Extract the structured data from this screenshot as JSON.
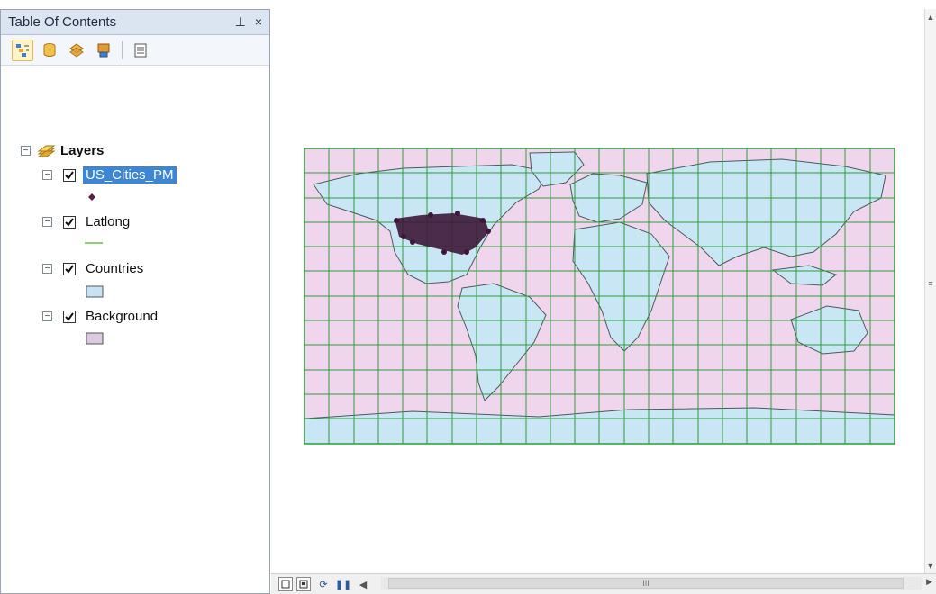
{
  "toc": {
    "title": "Table Of Contents",
    "pin_glyph": "⊥",
    "close_glyph": "×",
    "toolbar": [
      {
        "name": "list-by-drawing-order-icon"
      },
      {
        "name": "list-by-source-icon"
      },
      {
        "name": "list-by-visibility-icon"
      },
      {
        "name": "list-by-selection-icon"
      },
      {
        "name": "options-icon"
      }
    ],
    "root": {
      "label": "Layers"
    },
    "layers": [
      {
        "label": "US_Cities_PM",
        "checked": true,
        "selected": true,
        "symbol": "point",
        "color": "#5a1e4a"
      },
      {
        "label": "Latlong",
        "checked": true,
        "selected": false,
        "symbol": "line",
        "color": "#8dcf7a"
      },
      {
        "label": "Countries",
        "checked": true,
        "selected": false,
        "symbol": "fill",
        "color": "#c6e2f4"
      },
      {
        "label": "Background",
        "checked": true,
        "selected": false,
        "symbol": "fill",
        "color": "#dccbe0"
      }
    ]
  },
  "map": {
    "colors": {
      "background": "#efd6ec",
      "land": "#c9e6f5",
      "grid": "#2f9a3a",
      "borders": "#4a5a5a",
      "cities": "#3d1738"
    }
  },
  "bottom_bar": {
    "scroll_thumb_label": "III"
  }
}
